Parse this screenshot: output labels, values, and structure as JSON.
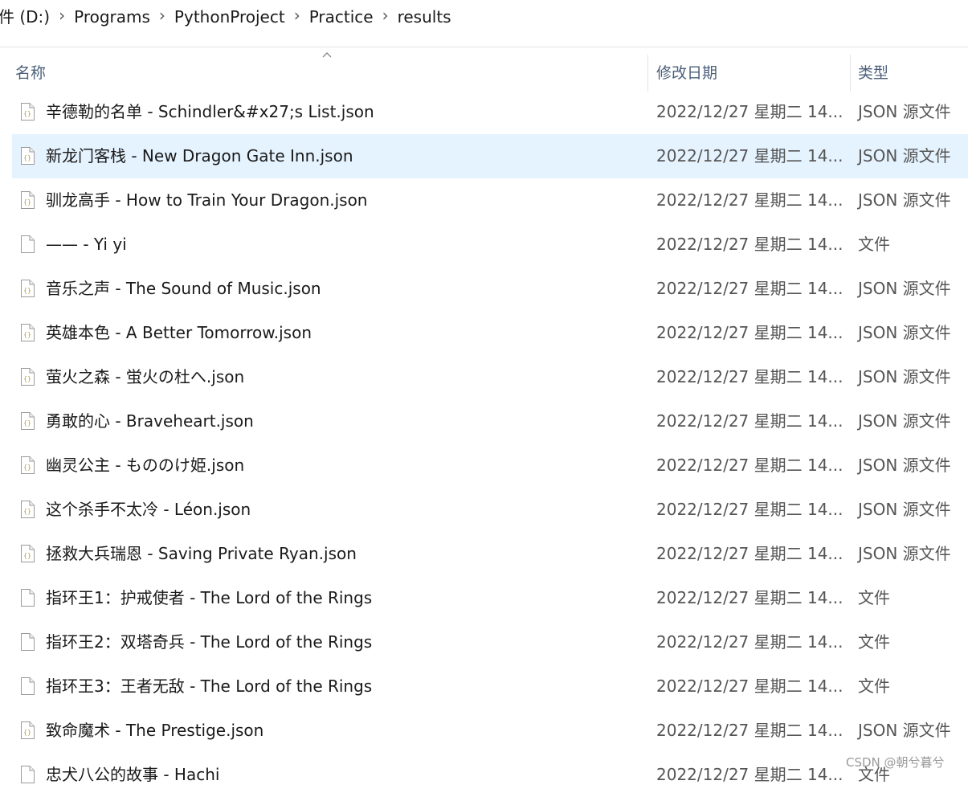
{
  "breadcrumb": [
    {
      "label": "件 (D:)"
    },
    {
      "label": "Programs"
    },
    {
      "label": "PythonProject"
    },
    {
      "label": "Practice"
    },
    {
      "label": "results"
    }
  ],
  "columns": {
    "name": "名称",
    "date": "修改日期",
    "type": "类型"
  },
  "selected_index": 1,
  "files": [
    {
      "name": "辛德勒的名单 - Schindler&#x27;s List.json",
      "date": "2022/12/27 星期二 14...",
      "type": "JSON 源文件",
      "icon": "json-file-icon"
    },
    {
      "name": "新龙门客栈 - New Dragon Gate Inn.json",
      "date": "2022/12/27 星期二 14...",
      "type": "JSON 源文件",
      "icon": "json-file-icon"
    },
    {
      "name": "驯龙高手 - How to Train Your Dragon.json",
      "date": "2022/12/27 星期二 14...",
      "type": "JSON 源文件",
      "icon": "json-file-icon"
    },
    {
      "name": "—— - Yi yi",
      "date": "2022/12/27 星期二 14...",
      "type": "文件",
      "icon": "file-icon"
    },
    {
      "name": "音乐之声 - The Sound of Music.json",
      "date": "2022/12/27 星期二 14...",
      "type": "JSON 源文件",
      "icon": "json-file-icon"
    },
    {
      "name": "英雄本色 - A Better Tomorrow.json",
      "date": "2022/12/27 星期二 14...",
      "type": "JSON 源文件",
      "icon": "json-file-icon"
    },
    {
      "name": "萤火之森 - 蛍火の杜へ.json",
      "date": "2022/12/27 星期二 14...",
      "type": "JSON 源文件",
      "icon": "json-file-icon"
    },
    {
      "name": "勇敢的心 - Braveheart.json",
      "date": "2022/12/27 星期二 14...",
      "type": "JSON 源文件",
      "icon": "json-file-icon"
    },
    {
      "name": "幽灵公主 - もののけ姫.json",
      "date": "2022/12/27 星期二 14...",
      "type": "JSON 源文件",
      "icon": "json-file-icon"
    },
    {
      "name": "这个杀手不太冷 - Léon.json",
      "date": "2022/12/27 星期二 14...",
      "type": "JSON 源文件",
      "icon": "json-file-icon"
    },
    {
      "name": "拯救大兵瑞恩 - Saving Private Ryan.json",
      "date": "2022/12/27 星期二 14...",
      "type": "JSON 源文件",
      "icon": "json-file-icon"
    },
    {
      "name": "指环王1：护戒使者 - The Lord of the Rings",
      "date": "2022/12/27 星期二 14...",
      "type": "文件",
      "icon": "file-icon"
    },
    {
      "name": "指环王2：双塔奇兵 - The Lord of the Rings",
      "date": "2022/12/27 星期二 14...",
      "type": "文件",
      "icon": "file-icon"
    },
    {
      "name": "指环王3：王者无敌 - The Lord of the Rings",
      "date": "2022/12/27 星期二 14...",
      "type": "文件",
      "icon": "file-icon"
    },
    {
      "name": "致命魔术 - The Prestige.json",
      "date": "2022/12/27 星期二 14...",
      "type": "JSON 源文件",
      "icon": "json-file-icon"
    },
    {
      "name": "忠犬八公的故事 - Hachi",
      "date": "2022/12/27 星期二 14...",
      "type": "文件",
      "icon": "file-icon"
    }
  ],
  "watermark": "CSDN @朝兮暮兮"
}
